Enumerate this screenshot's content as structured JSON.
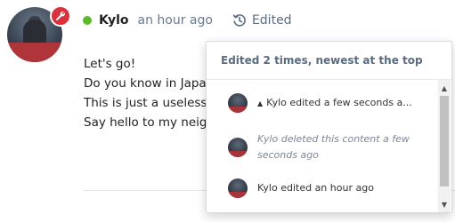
{
  "post": {
    "author": "Kylo",
    "time": "an hour ago",
    "edited_label": "Edited",
    "status_color": "#5cb82d",
    "badge_icon": "wrench-icon",
    "badge_color": "#d9323c",
    "lines": [
      "Let's go!",
      "Do you know in Japanese",
      "This is just a useless line",
      "Say hello to my neighbor"
    ]
  },
  "history": {
    "title": "Edited 2 times, newest at the top",
    "items": [
      {
        "text": "Kylo edited a few seconds a...",
        "icon": "caret-up-icon"
      },
      {
        "text": "Kylo deleted this content a few seconds ago"
      },
      {
        "text": "Kylo edited an hour ago"
      }
    ]
  }
}
